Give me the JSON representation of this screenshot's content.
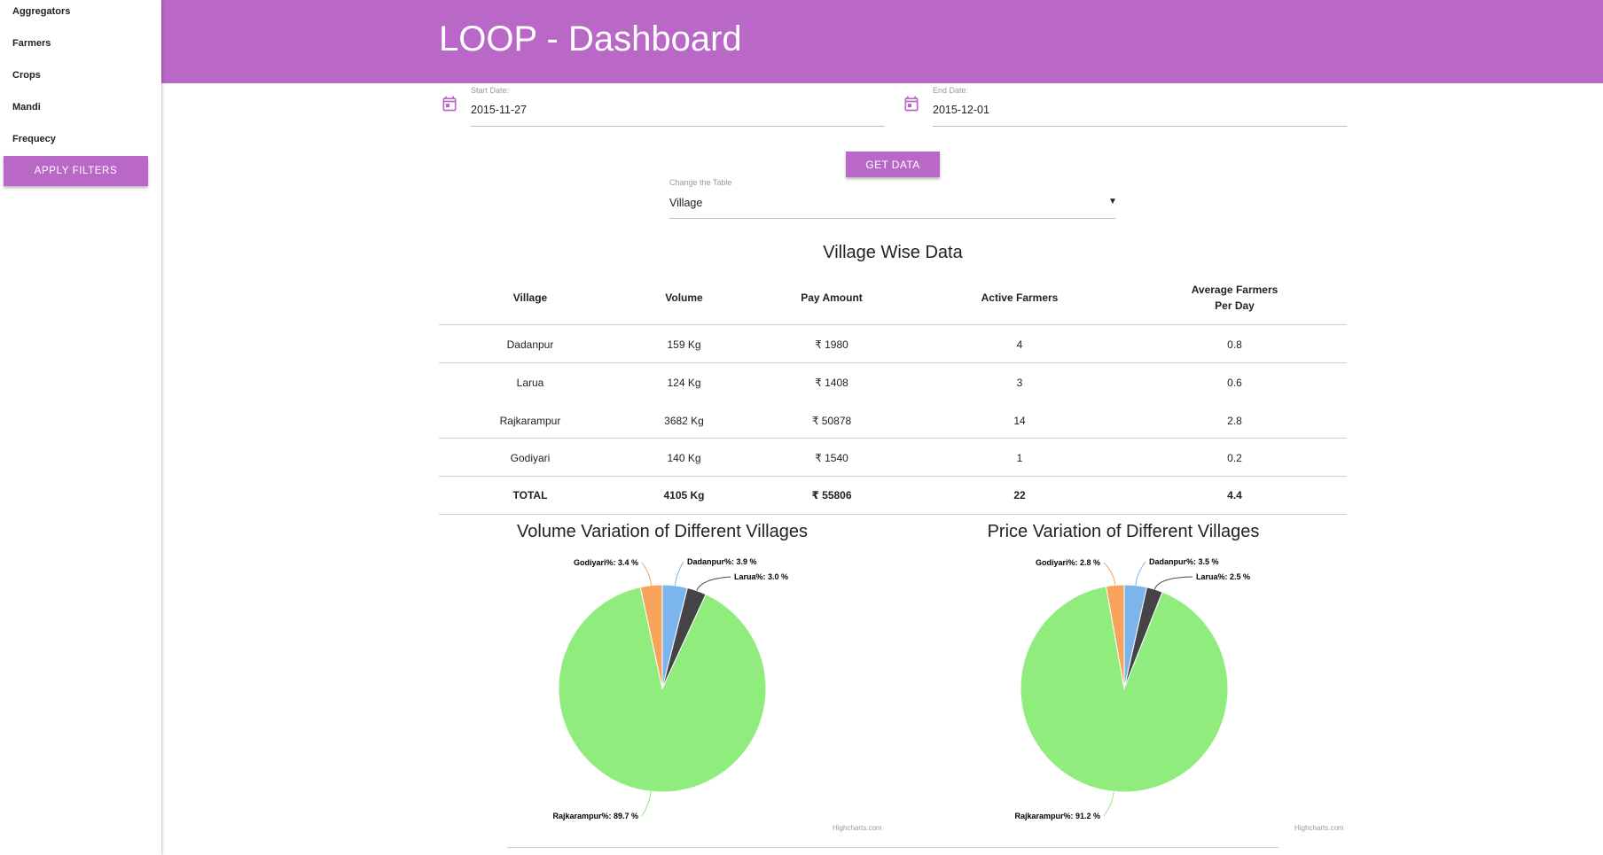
{
  "sidebar": {
    "items": [
      "Aggregators",
      "Farmers",
      "Crops",
      "Mandi",
      "Frequecy"
    ],
    "apply_label": "APPLY FILTERS"
  },
  "header": {
    "title": "LOOP - Dashboard"
  },
  "filters": {
    "start_label": "Start Date:",
    "start_value": "2015-11-27",
    "end_label": "End Date:",
    "end_value": "2015-12-01",
    "get_data_label": "GET DATA",
    "table_select_label": "Change the Table",
    "table_select_value": "Village"
  },
  "table": {
    "title": "Village Wise Data",
    "headers": [
      "Village",
      "Volume",
      "Pay Amount",
      "Active Farmers",
      "Average Farmers Per Day"
    ],
    "rows": [
      [
        "Dadanpur",
        "159 Kg",
        "₹ 1980",
        "4",
        "0.8"
      ],
      [
        "Larua",
        "124 Kg",
        "₹ 1408",
        "3",
        "0.6"
      ],
      [
        "Rajkarampur",
        "3682 Kg",
        "₹ 50878",
        "14",
        "2.8"
      ],
      [
        "Godiyari",
        "140 Kg",
        "₹ 1540",
        "1",
        "0.2"
      ]
    ],
    "total": [
      "TOTAL",
      "4105 Kg",
      "₹ 55806",
      "22",
      "4.4"
    ]
  },
  "colors": {
    "accent": "#ba68c8",
    "dadanpur": "#7cb5ec",
    "larua": "#434348",
    "rajkarampur": "#90ed7d",
    "godiyari": "#f7a35c"
  },
  "chart_data": [
    {
      "type": "pie",
      "title": "Volume Variation of Different Villages",
      "categories": [
        "Dadanpur",
        "Larua",
        "Rajkarampur",
        "Godiyari"
      ],
      "values": [
        3.9,
        3.0,
        89.7,
        3.4
      ],
      "labels": [
        "Dadanpur%: 3.9 %",
        "Larua%: 3.0 %",
        "Rajkarampur%: 89.7 %",
        "Godiyari%: 3.4 %"
      ],
      "credit": "Highcharts.com"
    },
    {
      "type": "pie",
      "title": "Price Variation of Different Villages",
      "categories": [
        "Dadanpur",
        "Larua",
        "Rajkarampur",
        "Godiyari"
      ],
      "values": [
        3.5,
        2.5,
        91.2,
        2.8
      ],
      "labels": [
        "Dadanpur%: 3.5 %",
        "Larua%: 2.5 %",
        "Rajkarampur%: 91.2 %",
        "Godiyari%: 2.8 %"
      ],
      "credit": "Highcharts.com"
    }
  ]
}
